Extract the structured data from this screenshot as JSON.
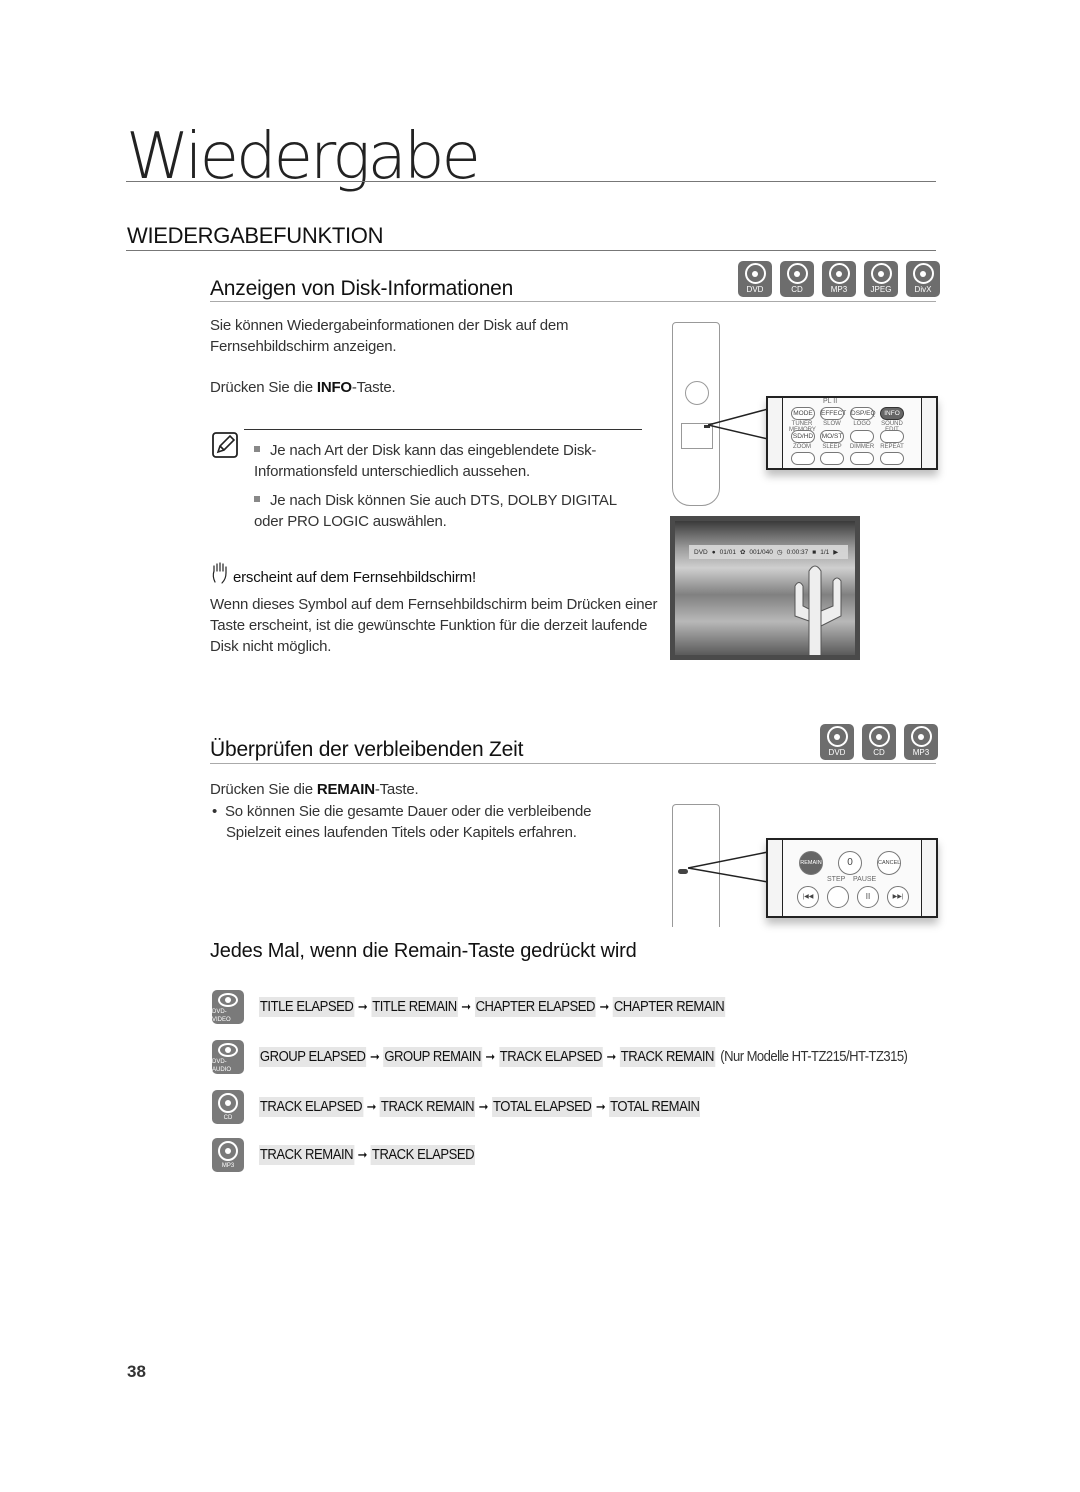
{
  "chapter": {
    "title": "Wiedergabe"
  },
  "section": {
    "title": "WIEDERGABEFUNKTION"
  },
  "disc_info": {
    "title": "Anzeigen von Disk-Informationen",
    "disc_types": [
      "DVD",
      "CD",
      "MP3",
      "JPEG",
      "DivX"
    ],
    "intro": "Sie können Wiedergabeinformationen der Disk auf dem Fernsehbildschirm anzeigen.",
    "press_prefix": "Drücken Sie die ",
    "press_key": "INFO",
    "press_suffix": "-Taste.",
    "notes": [
      "Je nach Art der Disk kann das eingeblendete Disk-Informationsfeld unterschiedlich aussehen.",
      "Je nach Disk können Sie auch DTS, DOLBY DIGITAL oder PRO LOGIC auswählen."
    ],
    "hand_heading": "erscheint auf dem Fernsehbildschirm!",
    "hand_text": "Wenn dieses Symbol auf dem Fernsehbildschirm beim Drücken einer Taste erscheint, ist die gewünschte Funktion für die derzeit laufende Disk nicht möglich.",
    "remote_zoom": {
      "top_label": "PL II",
      "row1": [
        "MODE",
        "EFFECT",
        "DSP/EQ",
        "INFO"
      ],
      "row2_labels": [
        "TUNER MEMORY",
        "SLOW",
        "LOGO",
        "SOUND EDIT"
      ],
      "row2": [
        "SD/HD",
        "MO/ST",
        "",
        ""
      ],
      "row3_labels": [
        "ZOOM",
        "SLEEP",
        "DIMMER",
        "REPEAT"
      ]
    },
    "osd": {
      "disc": "DVD",
      "title": "01/01",
      "chapter": "001/040",
      "time": "0:00:37",
      "angle": "1/1"
    }
  },
  "remain": {
    "title": "Überprüfen der verbleibenden Zeit",
    "disc_types": [
      "DVD",
      "CD",
      "MP3"
    ],
    "press_prefix": "Drücken Sie die ",
    "press_key": "REMAIN",
    "press_suffix": "-Taste.",
    "bullet": "So können Sie die gesamte Dauer oder die verbleibende Spielzeit eines laufenden Titels oder Kapitels erfahren.",
    "remote_zoom": {
      "row1": [
        "REMAIN",
        "0",
        "CANCEL"
      ],
      "labels": [
        "STEP",
        "PAUSE"
      ],
      "row2": [
        "|◀◀",
        "",
        "II",
        "▶▶|"
      ]
    }
  },
  "sequence": {
    "title": "Jedes Mal, wenn die Remain-Taste gedrückt wird",
    "rows": [
      {
        "disc": "DVD-VIDEO",
        "steps": [
          "TITLE ELAPSED",
          "TITLE REMAIN",
          "CHAPTER ELAPSED",
          "CHAPTER REMAIN"
        ],
        "note": ""
      },
      {
        "disc": "DVD-AUDIO",
        "steps": [
          "GROUP ELAPSED",
          "GROUP REMAIN",
          "TRACK ELAPSED",
          "TRACK REMAIN"
        ],
        "note": "(Nur Modelle HT-TZ215/HT-TZ315)"
      },
      {
        "disc": "CD",
        "steps": [
          "TRACK ELAPSED",
          "TRACK REMAIN",
          "TOTAL ELAPSED",
          "TOTAL REMAIN"
        ],
        "note": ""
      },
      {
        "disc": "MP3",
        "steps": [
          "TRACK REMAIN",
          "TRACK ELAPSED"
        ],
        "note": ""
      }
    ],
    "arrow": "➞"
  },
  "page_number": "38"
}
